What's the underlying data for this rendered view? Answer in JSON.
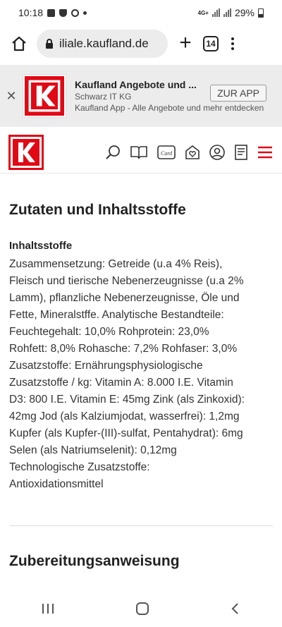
{
  "status_bar": {
    "time": "10:18",
    "network": "4G+",
    "battery": "29%"
  },
  "browser": {
    "url": "iliale.kaufland.de",
    "tab_count": "14"
  },
  "app_banner": {
    "title": "Kaufland Angebote und ...",
    "publisher": "Schwarz IT KG",
    "description": "Kaufland App - Alle Angebote und mehr entdecken",
    "cta": "ZUR APP"
  },
  "brand": {
    "accent": "#e10915"
  },
  "content": {
    "section_title": "Zutaten und Inhaltsstoffe",
    "subheading": "Inhaltsstoffe",
    "lines": [
      "Zusammensetzung: Getreide (u.a 4% Reis),",
      "Fleisch und tierische Nebenerzeugnisse (u.a 2%",
      "Lamm), pflanzliche Nebenerzeugnisse, Öle und",
      "Fette, Mineralstffe. Analytische Bestandteile:",
      "Feuchtegehalt: 10,0% Rohprotein: 23,0%",
      "Rohfett: 8,0% Rohasche: 7,2% Rohfaser: 3,0%",
      "Zusatzstoffe: Ernährungsphysiologische",
      "Zusatzstoffe / kg: Vitamin A: 8.000 I.E. Vitamin",
      "D3: 800 I.E. Vitamin E: 45mg Zink (als Zinkoxid):",
      "42mg Jod (als Kalziumjodat, wasserfrei): 1,2mg",
      "Kupfer (als Kupfer-(III)-sulfat, Pentahydrat): 6mg",
      "Selen (als Natriumselenit): 0,12mg",
      "Technologische Zusatzstoffe:",
      "Antioxidationsmittel"
    ],
    "section2_title": "Zubereitungsanweisung"
  },
  "icons": {
    "header": [
      "search-icon",
      "brochure-icon",
      "card-icon",
      "favorite-store-icon",
      "account-icon",
      "shopping-list-icon",
      "menu-icon"
    ],
    "nav": [
      "recents-icon",
      "home-icon",
      "back-icon"
    ]
  }
}
